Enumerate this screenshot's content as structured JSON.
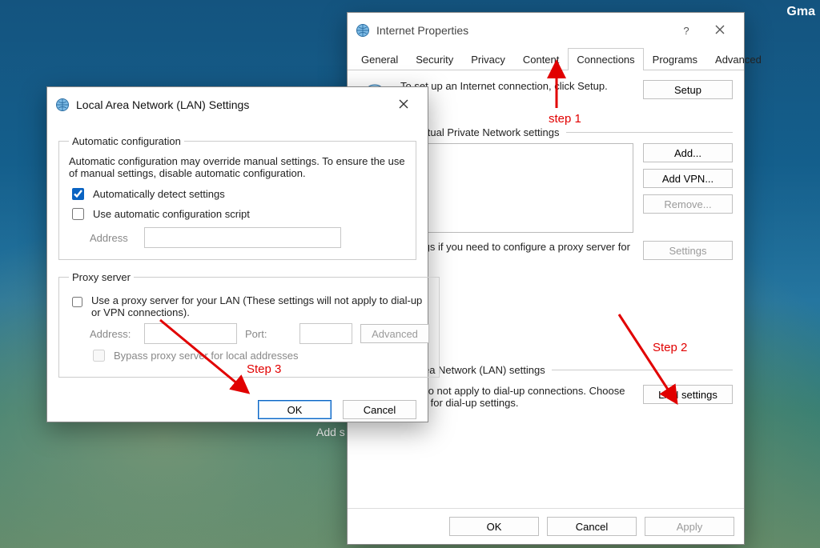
{
  "desktop": {
    "topRight": "Gma"
  },
  "ipDialog": {
    "title": "Internet Properties",
    "tabs": [
      "General",
      "Security",
      "Privacy",
      "Content",
      "Connections",
      "Programs",
      "Advanced"
    ],
    "setup": {
      "text": "To set up an Internet connection, click Setup.",
      "btn": "Setup"
    },
    "vpnGroup": {
      "legend": "Dial-up and Virtual Private Network settings",
      "btns": {
        "add": "Add...",
        "addVpn": "Add VPN...",
        "remove": "Remove...",
        "settings": "Settings"
      },
      "hint": "Choose Settings if you need to configure a proxy server for a connection."
    },
    "lanGroup": {
      "legend": "Local Area Network (LAN) settings",
      "text": "LAN Settings do not apply to dial-up connections. Choose Settings above for dial-up settings.",
      "btn": "LAN settings"
    },
    "footer": {
      "ok": "OK",
      "cancel": "Cancel",
      "apply": "Apply"
    }
  },
  "lanDialog": {
    "title": "Local Area Network (LAN) Settings",
    "autoGroup": {
      "legend": "Automatic configuration",
      "desc": "Automatic configuration may override manual settings.  To ensure the use of manual settings, disable automatic configuration.",
      "chkAuto": "Automatically detect settings",
      "chkScript": "Use automatic configuration script",
      "addressLabel": "Address"
    },
    "proxyGroup": {
      "legend": "Proxy server",
      "chkUse": "Use a proxy server for your LAN (These settings will not apply to dial-up or VPN connections).",
      "addressLabel": "Address:",
      "portLabel": "Port:",
      "advanced": "Advanced",
      "chkBypass": "Bypass proxy server for local addresses"
    },
    "footer": {
      "ok": "OK",
      "cancel": "Cancel"
    }
  },
  "annotations": {
    "step1": "step 1",
    "step2": "Step 2",
    "step3": "Step 3",
    "addShortcut": "Add s"
  }
}
